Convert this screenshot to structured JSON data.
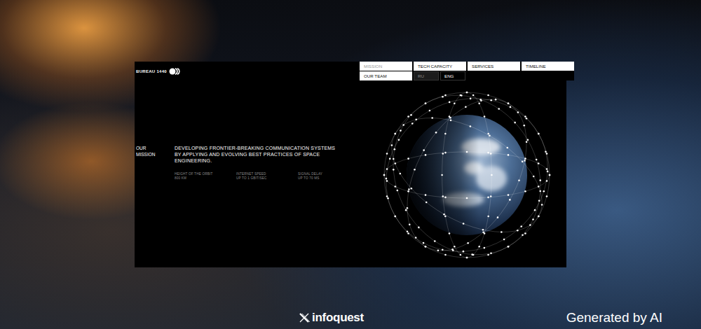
{
  "logo": {
    "text": "BUREAU 1440"
  },
  "nav": {
    "rows": [
      [
        {
          "label": "MISSION",
          "selected": true,
          "kind": "page"
        },
        {
          "label": "TECH CAPACITY",
          "selected": false,
          "kind": "page"
        },
        {
          "label": "SERVICES",
          "selected": false,
          "kind": "page"
        },
        {
          "label": "TIMELINE",
          "selected": false,
          "kind": "page"
        }
      ],
      [
        {
          "label": "OUR TEAM",
          "selected": false,
          "kind": "page"
        },
        {
          "label": "RU",
          "selected": false,
          "kind": "language"
        },
        {
          "label": "ENG",
          "selected": true,
          "kind": "language"
        }
      ]
    ]
  },
  "mission": {
    "label": "OUR MISSION",
    "text": "DEVELOPING FRONTIER-BREAKING COMMUNICATION SYSTEMS BY APPLYING AND EVOLVING BEST PRACTICES OF SPACE ENGINEERING."
  },
  "stats": [
    {
      "label": "HEIGHT OF THE ORBIT",
      "value": "800 KM"
    },
    {
      "label": "INTERNET SPEED",
      "value": "UP TO 1 GBIT/SEC"
    },
    {
      "label": "SIGNAL DELAY",
      "value": "UP TO 70 MS"
    }
  ],
  "footer": {
    "brand": "infoquest",
    "badge": "Generated by AI"
  }
}
